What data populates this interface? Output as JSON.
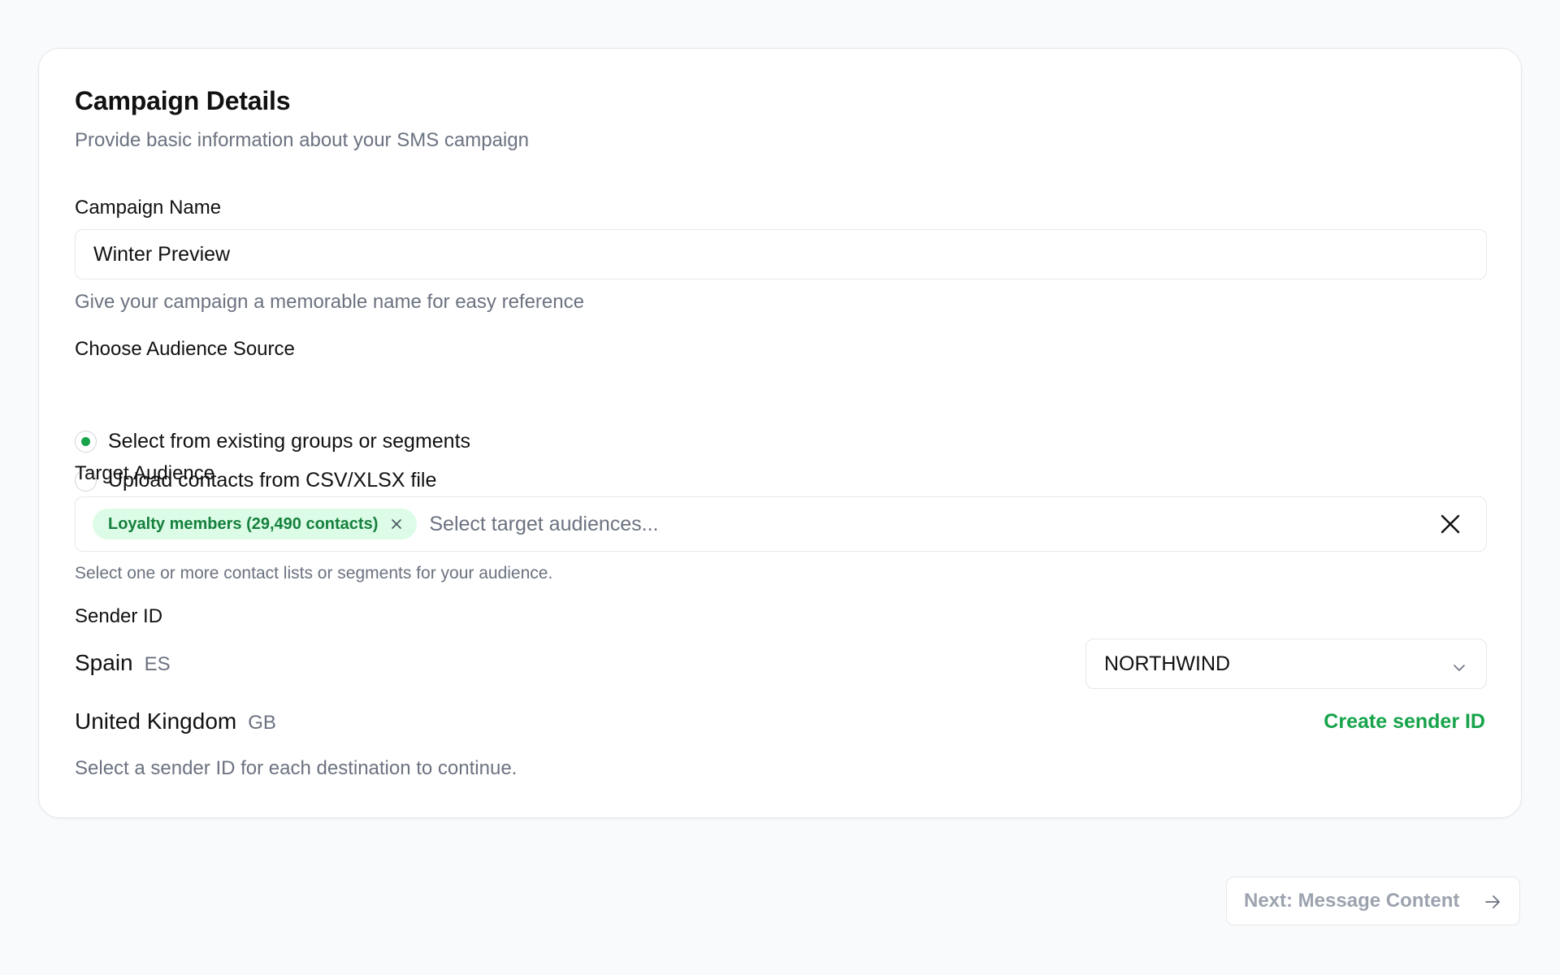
{
  "card": {
    "title": "Campaign Details",
    "subtitle": "Provide basic information about your SMS campaign"
  },
  "campaign_name": {
    "label": "Campaign Name",
    "value": "Winter Preview",
    "helper": "Give your campaign a memorable name for easy reference"
  },
  "audience_source": {
    "label": "Choose Audience Source",
    "options": [
      {
        "label": "Select from existing groups or segments",
        "checked": true
      },
      {
        "label": "Upload contacts from CSV/XLSX file",
        "checked": false
      }
    ]
  },
  "target_audience": {
    "label": "Target Audience",
    "chips": [
      {
        "label": "Loyalty members (29,490 contacts)"
      }
    ],
    "placeholder": "Select target audiences...",
    "helper": "Select one or more contact lists or segments for your audience."
  },
  "sender_id": {
    "label": "Sender ID",
    "rows": [
      {
        "country": "Spain",
        "code": "ES",
        "selected": "NORTHWIND"
      },
      {
        "country": "United Kingdom",
        "code": "GB",
        "action": "Create sender ID"
      }
    ],
    "helper": "Select a sender ID for each destination to continue."
  },
  "footer": {
    "next_label": "Next: Message Content"
  },
  "colors": {
    "accent": "#16a34a",
    "chip_bg": "#dcfce7",
    "chip_text": "#15803d",
    "muted_text": "#6b7280",
    "border": "#e5e7eb"
  },
  "icons": {
    "chip_remove": "close-icon",
    "clear_all": "close-icon",
    "select": "chevron-down-icon",
    "next": "arrow-right-icon"
  }
}
